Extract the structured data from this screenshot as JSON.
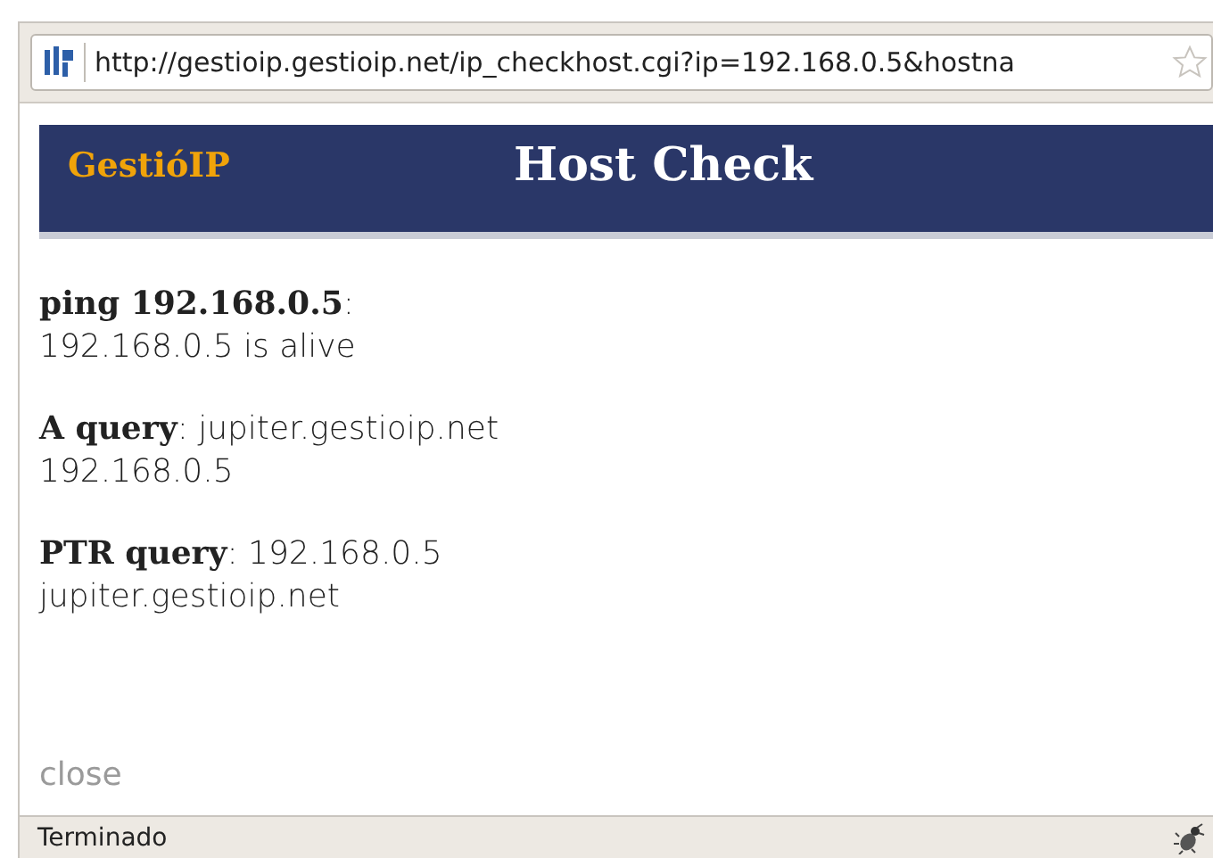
{
  "address_bar": {
    "url": "http://gestioip.gestioip.net/ip_checkhost.cgi?ip=192.168.0.5&hostna"
  },
  "header": {
    "logo": "GestióIP",
    "title": "Host Check"
  },
  "results": [
    {
      "heading": "**ping 192.168.0.5**:",
      "value": "192.168.0.5 is alive"
    },
    {
      "heading": "**A query**: jupiter.gestioip.net",
      "value": "192.168.0.5"
    },
    {
      "heading": "**PTR query**: 192.168.0.5",
      "value": "jupiter.gestioip.net"
    }
  ],
  "close_link": "close",
  "status_bar": {
    "text": "Terminado"
  }
}
